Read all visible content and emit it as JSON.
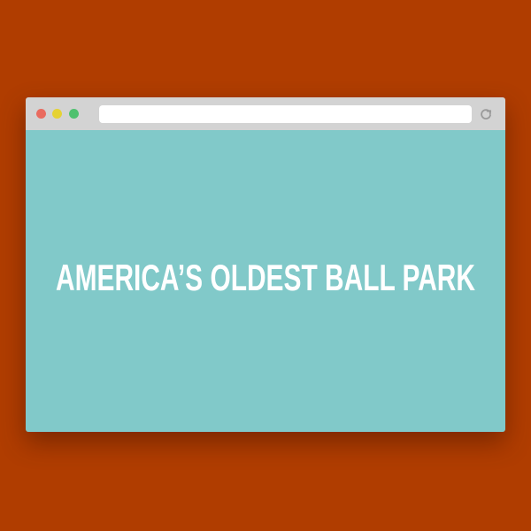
{
  "page": {
    "background_color": "#b03d00"
  },
  "window": {
    "controls": [
      {
        "name": "close",
        "color": "#e96b5f"
      },
      {
        "name": "minimize",
        "color": "#e5d234"
      },
      {
        "name": "maximize",
        "color": "#4fc16f"
      }
    ],
    "address_bar": {
      "value": ""
    },
    "reload_icon": "reload-icon"
  },
  "content": {
    "background_color": "#81c9c9",
    "headline": "AMERICA'S OLDEST BALL PARK",
    "headline_display": "AMERICA’S OLDEST BALL PARK",
    "text_color": "#ffffff"
  }
}
